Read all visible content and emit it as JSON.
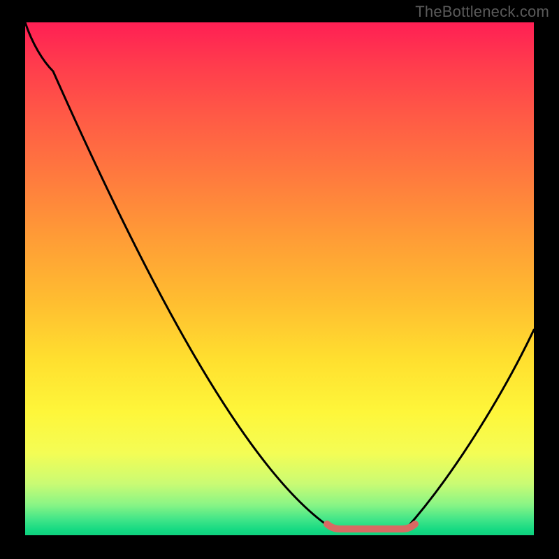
{
  "watermark": "TheBottleneck.com",
  "chart_data": {
    "type": "line",
    "title": "",
    "xlabel": "",
    "ylabel": "",
    "xlim": [
      0,
      100
    ],
    "ylim": [
      0,
      100
    ],
    "grid": false,
    "legend": false,
    "background": "rainbow-gradient (red top → green bottom)",
    "series": [
      {
        "name": "bottleneck-curve",
        "color": "#000000",
        "x": [
          0,
          5,
          10,
          20,
          30,
          40,
          50,
          58,
          62,
          70,
          75,
          82,
          90,
          100
        ],
        "y": [
          100,
          94,
          90,
          72,
          55,
          38,
          22,
          8,
          1,
          1,
          1,
          8,
          22,
          40
        ]
      },
      {
        "name": "optimum-range-highlight",
        "color": "#d86a63",
        "x": [
          60,
          62,
          70,
          75,
          77
        ],
        "y": [
          2,
          1,
          1,
          1,
          2
        ]
      }
    ],
    "annotations": []
  }
}
